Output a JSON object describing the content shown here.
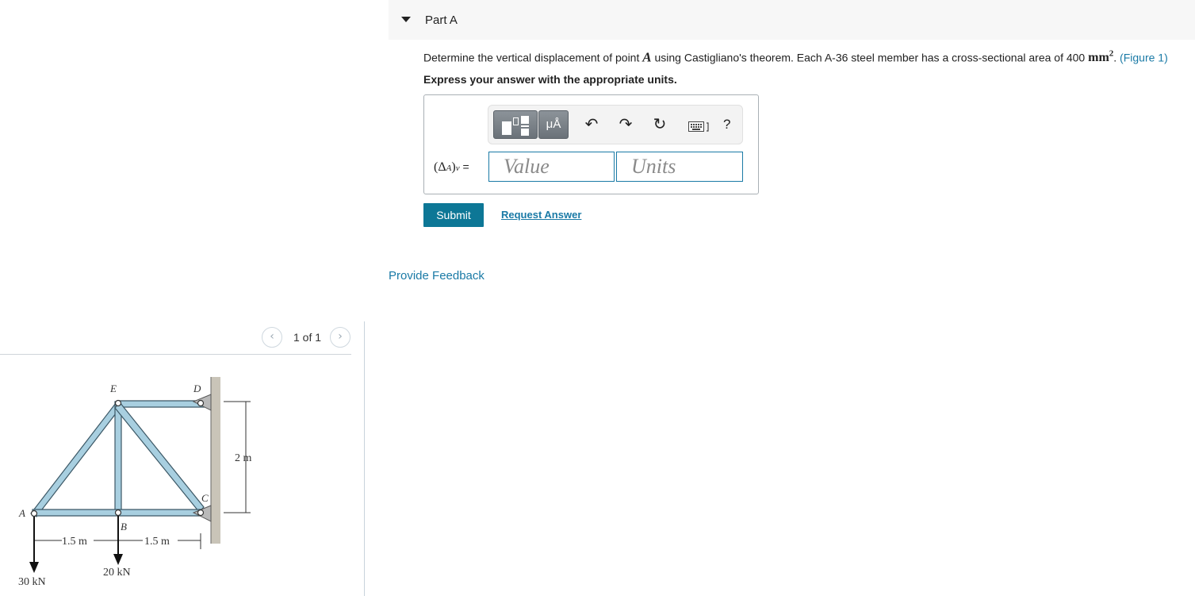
{
  "pager": {
    "prev_icon": "chevron-left-icon",
    "next_icon": "chevron-right-icon",
    "text": "1 of 1"
  },
  "figure": {
    "joint_labels": [
      "A",
      "B",
      "C",
      "D",
      "E"
    ],
    "dim_height": "2 m",
    "dim_span_left": "1.5 m",
    "dim_span_right": "1.5 m",
    "load_a": "30 kN",
    "load_b": "20 kN",
    "member_color": "#a8cfe0",
    "wall_color": "#c9c4b8"
  },
  "part": {
    "title": "Part A",
    "caret_icon": "caret-down-icon"
  },
  "question": {
    "text_before": "Determine the vertical displacement of point ",
    "point": "A",
    "text_middle": " using Castigliano's theorem. Each A-36 steel member has a cross-sectional area of 400 ",
    "unit": "mm",
    "unit_exp": "2",
    "text_after": ". ",
    "figure_link": "(Figure 1)"
  },
  "instruction": "Express your answer with the appropriate units.",
  "toolbar": {
    "templates_icon": "templates-icon",
    "symbols_label": "μÅ",
    "undo_icon": "undo-icon",
    "redo_icon": "redo-icon",
    "reset_icon": "reset-icon",
    "keyboard_icon": "keyboard-icon",
    "help_label": "?"
  },
  "answer": {
    "label_delta": "(Δ",
    "label_sub": "A",
    "label_close": ")",
    "label_sub2": "v",
    "label_eq": " =",
    "value_placeholder": "Value",
    "units_placeholder": "Units"
  },
  "actions": {
    "submit_label": "Submit",
    "request_label": "Request Answer",
    "feedback_label": "Provide Feedback"
  },
  "colors": {
    "accent": "#0d7796",
    "link": "#1a7aa6",
    "header_bg": "#f7f7f7"
  }
}
